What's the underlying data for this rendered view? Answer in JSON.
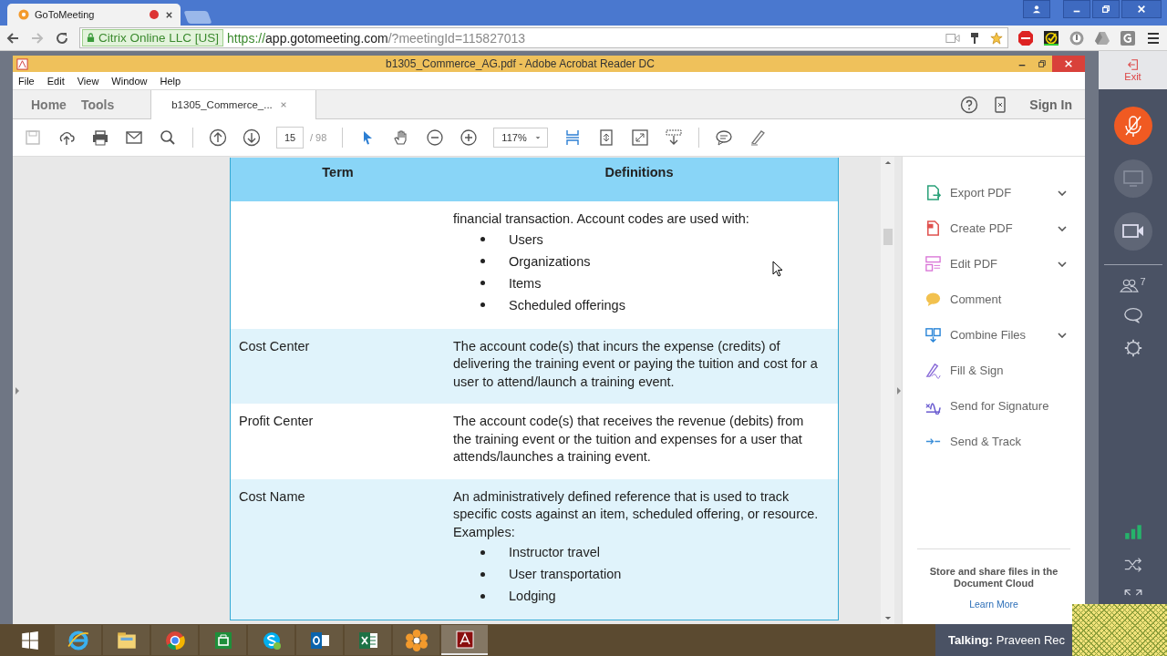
{
  "browser": {
    "tab_title": "GoToMeeting",
    "org": "Citrix Online LLC [US]",
    "url_scheme": "https://",
    "url_host": "app.gotomeeting.com",
    "url_path": "/?meetingId=115827013"
  },
  "acrobat": {
    "title": "b1305_Commerce_AG.pdf - Adobe Acrobat Reader DC",
    "menu": [
      "File",
      "Edit",
      "View",
      "Window",
      "Help"
    ],
    "nav_tabs": [
      {
        "label": "Home",
        "selected": false
      },
      {
        "label": "Tools",
        "selected": false
      }
    ],
    "doc_tab": "b1305_Commerce_...",
    "sign_in": "Sign In",
    "page": "15",
    "page_total": "/ 98",
    "zoom": "117%"
  },
  "table": {
    "columns": [
      "Term",
      "Definitions"
    ],
    "rows": [
      {
        "shaded": false,
        "definition": "financial transaction. Account codes are used with:",
        "bullets": [
          "Users",
          "Organizations",
          "Items",
          "Scheduled offerings"
        ]
      },
      {
        "shaded": true,
        "term": "Cost Center",
        "definition": "The account code(s) that incurs the expense (credits) of delivering the training event or paying the tuition and cost for a user to attend/launch a training event."
      },
      {
        "shaded": false,
        "term": "Profit Center",
        "definition": "The account code(s) that receives the revenue (debits) from the training event or the tuition and expenses for a user that attends/launches a training event."
      },
      {
        "shaded": true,
        "term": "Cost Name",
        "definition": "An administratively defined reference that is used to track specific costs against an item, scheduled offering, or resource. Examples:",
        "bullets": [
          "Instructor travel",
          "User transportation",
          "Lodging"
        ]
      }
    ]
  },
  "tools": {
    "items": [
      {
        "kind": "export",
        "label": "Export PDF",
        "expandable": true
      },
      {
        "kind": "create",
        "label": "Create PDF",
        "expandable": true
      },
      {
        "kind": "edit",
        "label": "Edit PDF",
        "expandable": true
      },
      {
        "kind": "comment",
        "label": "Comment",
        "expandable": false
      },
      {
        "kind": "combine",
        "label": "Combine Files",
        "expandable": true
      },
      {
        "kind": "fill",
        "label": "Fill & Sign",
        "expandable": false
      },
      {
        "kind": "signature",
        "label": "Send for Signature",
        "expandable": false
      },
      {
        "kind": "track",
        "label": "Send & Track",
        "expandable": false
      }
    ],
    "cloud_text": "Store and share files in the Document Cloud",
    "learn_more": "Learn More"
  },
  "meeting_panel": {
    "exit": "Exit",
    "attendee_count": "7"
  },
  "taskbar": {
    "talking_label": "Talking:",
    "talking_name": "Praveen Rec"
  }
}
